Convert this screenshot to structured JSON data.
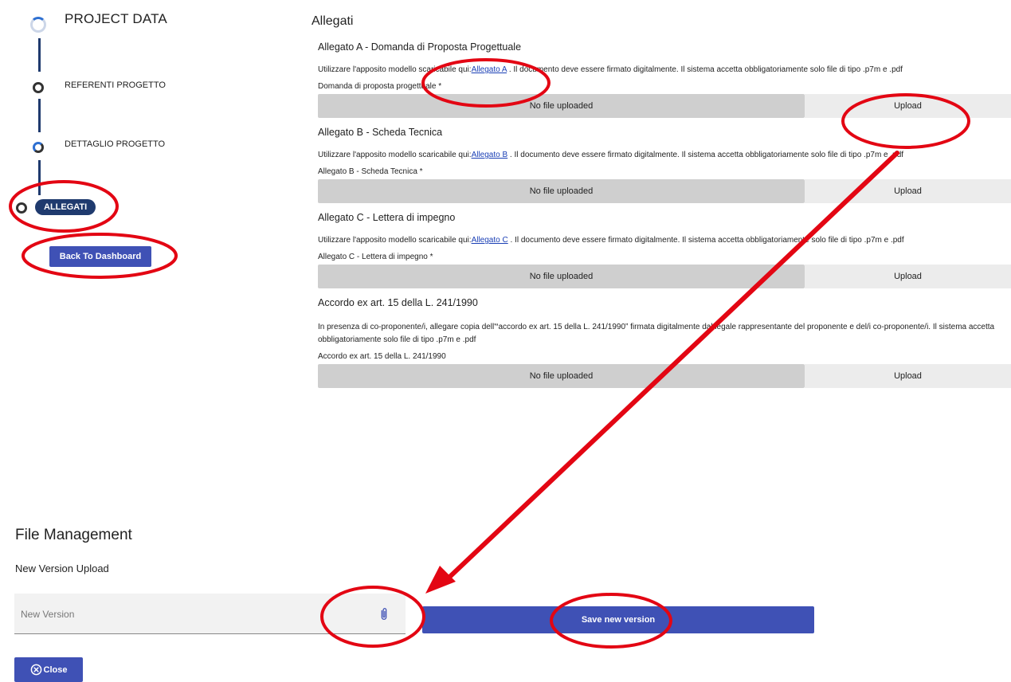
{
  "stepper": {
    "title": "PROJECT DATA",
    "steps": [
      {
        "label": "REFERENTI PROGETTO"
      },
      {
        "label": "DETTAGLIO PROGETTO"
      },
      {
        "label": "ALLEGATI",
        "active": true
      }
    ],
    "back_label": "Back To Dashboard"
  },
  "attachments": {
    "title": "Allegati",
    "sections": [
      {
        "title": "Allegato A - Domanda di Proposta Progettuale",
        "desc_before": "Utilizzare l'apposito modello scaricabile qui:",
        "link": "Allegato A",
        "desc_after": " . Il documento deve essere firmato digitalmente. Il sistema accetta obbligatoriamente solo file di tipo .p7m e .pdf",
        "field_label": "Domanda di proposta progettuale *",
        "file_status": "No file uploaded",
        "upload_label": "Upload"
      },
      {
        "title": "Allegato B - Scheda Tecnica",
        "desc_before": "Utilizzare l'apposito modello scaricabile qui:",
        "link": "Allegato B",
        "desc_after": " . Il documento deve essere firmato digitalmente. Il sistema accetta obbligatoriamente solo file di tipo .p7m e .pdf",
        "field_label": "Allegato B - Scheda Tecnica *",
        "file_status": "No file uploaded",
        "upload_label": "Upload"
      },
      {
        "title": "Allegato C - Lettera di impegno",
        "desc_before": "Utilizzare l'apposito modello scaricabile qui:",
        "link": "Allegato C",
        "desc_after": " . Il documento deve essere firmato digitalmente. Il sistema accetta obbligatoriamente solo file di tipo .p7m e .pdf",
        "field_label": "Allegato C - Lettera di impegno *",
        "file_status": "No file uploaded",
        "upload_label": "Upload"
      },
      {
        "title": "Accordo ex art. 15 della L. 241/1990",
        "desc": "In presenza di co-proponente/i, allegare copia dell'“accordo ex art. 15 della L. 241/1990” firmata digitalmente dal legale rappresentante del proponente e del/i co-proponente/i. Il sistema accetta obbligatoriamente solo file di tipo .p7m e .pdf",
        "field_label": "Accordo ex art. 15 della L. 241/1990",
        "file_status": "No file uploaded",
        "upload_label": "Upload"
      }
    ]
  },
  "file_management": {
    "title": "File Management",
    "subtitle": "New Version Upload",
    "input_placeholder": "New Version",
    "attach_icon": "paperclip-icon",
    "save_label": "Save new version",
    "close_label": "Close",
    "close_icon": "close-circle-icon"
  },
  "colors": {
    "primary": "#3f51b5",
    "navy": "#1f3a6e",
    "annotation": "#e30613",
    "file_box": "#cfcfcf",
    "upload_bg": "#ececec"
  }
}
